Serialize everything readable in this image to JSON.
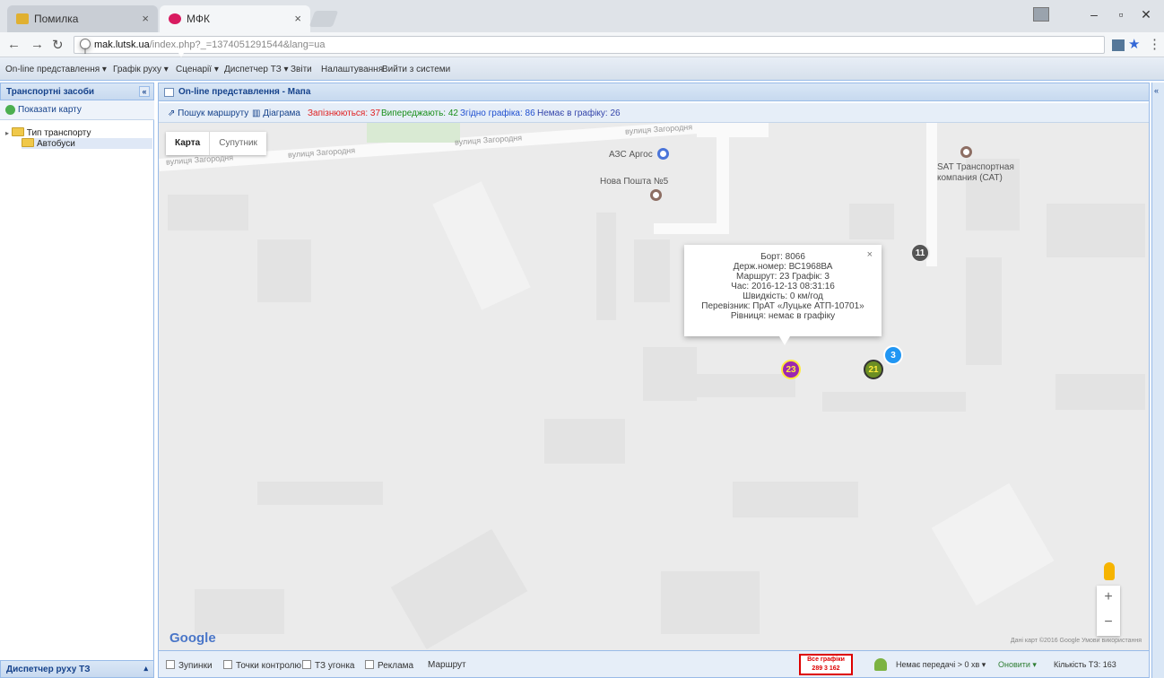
{
  "browser": {
    "tabs": [
      {
        "title": "Помилка",
        "favicon_color": "#e0b030"
      },
      {
        "title": "МФК",
        "favicon_color": "#d81b60"
      }
    ],
    "address": {
      "host": "mak.lutsk.ua",
      "path": "/index.php?_=1374051291544&lang=ua"
    }
  },
  "menu": {
    "items": [
      "On-line представлення ▾",
      "Графік руху ▾",
      "Сценарії ▾",
      "Диспетчер ТЗ ▾",
      "Звіти",
      "Налаштування",
      "Вийти з системи"
    ]
  },
  "left_panel": {
    "title": "Транспортні засоби",
    "show_map": "Показати карту",
    "tree": [
      {
        "label": "Тип транспорту"
      },
      {
        "label": "Автобуси"
      }
    ],
    "bottom_title": "Диспетчер руху ТЗ"
  },
  "main_panel": {
    "title": "On-line представлення - Мапа",
    "toolbar": {
      "search_route": "Пошук маршруту",
      "diagram": "Діаграма",
      "late": "Запізнюються: 37",
      "ahead": "Випереджають: 42",
      "on_schedule": "Згідно графіка: 86",
      "off_schedule": "Немає в графіку: 26",
      "colors": {
        "late": "#e02020",
        "ahead": "#1a8f1a",
        "on_schedule": "#1f4fd0",
        "off_schedule": "#3344aa"
      }
    }
  },
  "map": {
    "type_map": "Карта",
    "type_satellite": "Супутник",
    "streets": [
      "вулиця Загородня",
      "вулиця Загородня",
      "вулиця Загородня",
      "вулиця Загородня"
    ],
    "pois": {
      "gas": "АЗС Аргос",
      "post": "Нова Пошта №5",
      "sat": "SAT Транспортная компания (САТ)"
    },
    "popup": {
      "lines": [
        "Борт: 8066",
        "Держ.номер: ВС1968ВА",
        "Маршрут: 23 Графік: 3",
        "Час: 2016-12-13 08:31:16",
        "Швидкість: 0 км/год",
        "Перевізник: ПрАТ «Луцьке АТП-10701»",
        "Рівниця: немає в графіку"
      ]
    },
    "markers": [
      {
        "label": "11",
        "color": "#666666"
      },
      {
        "label": "23",
        "color": "#9c27b0"
      },
      {
        "label": "21",
        "color": "#6b8e23"
      },
      {
        "label": "3",
        "color": "#2196f3"
      }
    ],
    "google": "Google",
    "attribution": "Дані карт ©2016 Google  Умови використання"
  },
  "bottom": {
    "checkboxes": [
      "Зупинки",
      "Точки контролю",
      "ТЗ угонка",
      "Реклама"
    ],
    "route": "Маршрут",
    "schedule_badge": "Все графіки",
    "schedule_nums": "289  3  162",
    "right_items": [
      "Немає передачі > 0 хв ▾",
      "Оновити ▾",
      "Кількість ТЗ: 163"
    ]
  }
}
